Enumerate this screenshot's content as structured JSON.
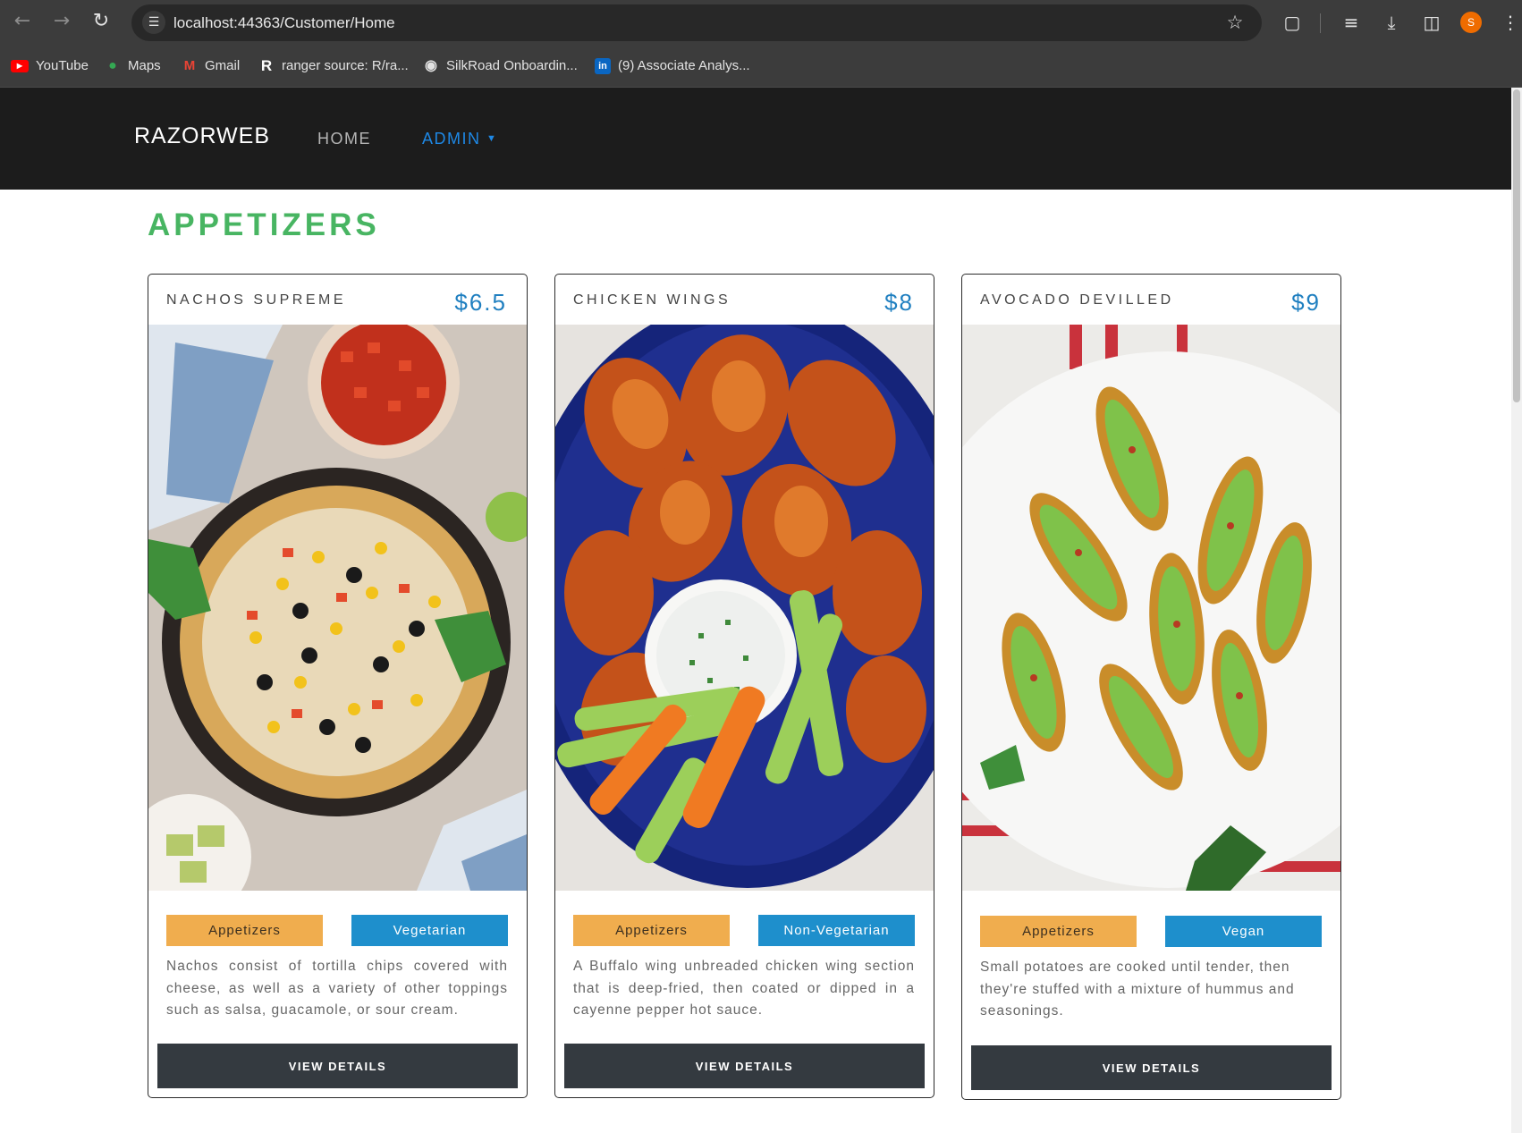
{
  "browser": {
    "url": "localhost:44363/Customer/Home",
    "profile_initial": "S",
    "bookmarks": [
      {
        "label": "YouTube",
        "icon": "youtube-icon"
      },
      {
        "label": "Maps",
        "icon": "maps-icon"
      },
      {
        "label": "Gmail",
        "icon": "gmail-icon"
      },
      {
        "label": "ranger source: R/ra...",
        "icon": "r-icon"
      },
      {
        "label": "SilkRoad Onboardin...",
        "icon": "globe-icon"
      },
      {
        "label": "(9) Associate Analys...",
        "icon": "linkedin-icon"
      }
    ]
  },
  "site": {
    "brand": "RAZORWEB",
    "nav": {
      "home": "HOME",
      "admin": "ADMIN"
    }
  },
  "section": {
    "title": "APPETIZERS"
  },
  "menu_items": [
    {
      "name": "NACHOS SUPREME",
      "price": "$6.5",
      "image": "nachos-photo",
      "category": "Appetizers",
      "diet": "Vegetarian",
      "description": "Nachos consist of tortilla chips covered with cheese, as well as a variety of other toppings such as salsa, guacamole, or sour cream.",
      "button": "VIEW DETAILS"
    },
    {
      "name": "CHICKEN WINGS",
      "price": "$8",
      "image": "chicken-wings-photo",
      "category": "Appetizers",
      "diet": "Non-Vegetarian",
      "description": "A Buffalo wing unbreaded chicken wing section that is deep-fried, then coated or dipped in a cayenne pepper hot sauce.",
      "button": "VIEW DETAILS"
    },
    {
      "name": "AVOCADO DEVILLED",
      "price": "$9",
      "image": "avocado-potatoes-photo",
      "category": "Appetizers",
      "diet": "Vegan",
      "description": "Small potatoes are cooked until tender, then they're stuffed with a mixture of hummus and seasonings.",
      "button": "VIEW DETAILS"
    }
  ],
  "colors": {
    "section_title": "#48b562",
    "price": "#1f7fc0",
    "tag_category": "#f0ad4e",
    "tag_diet": "#1e8fcc",
    "button": "#343a40",
    "nav_active": "#1e88e5"
  }
}
